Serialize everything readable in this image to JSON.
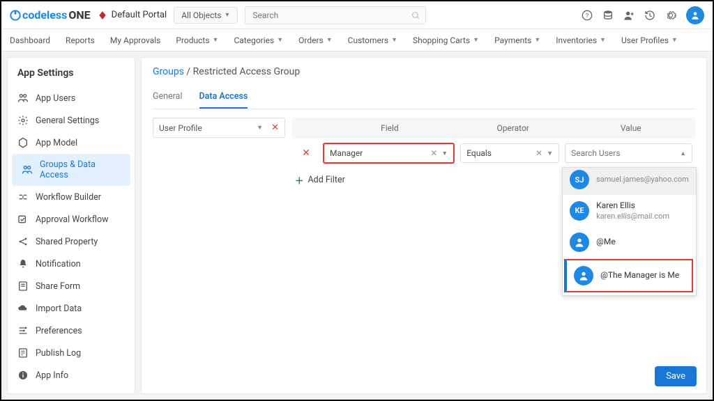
{
  "header": {
    "logo_prefix": "codeless",
    "logo_suffix": "ONE",
    "portal_label": "Default Portal",
    "objects_dd": "All Objects",
    "search_placeholder": "Search"
  },
  "nav": [
    {
      "label": "Dashboard",
      "dd": false
    },
    {
      "label": "Reports",
      "dd": false
    },
    {
      "label": "My Approvals",
      "dd": false
    },
    {
      "label": "Products",
      "dd": true
    },
    {
      "label": "Categories",
      "dd": true
    },
    {
      "label": "Orders",
      "dd": true
    },
    {
      "label": "Customers",
      "dd": true
    },
    {
      "label": "Shopping Carts",
      "dd": true
    },
    {
      "label": "Payments",
      "dd": true
    },
    {
      "label": "Inventories",
      "dd": true
    },
    {
      "label": "User Profiles",
      "dd": true
    }
  ],
  "sidebar": {
    "title": "App Settings",
    "items": [
      {
        "label": "App Users",
        "icon": "users"
      },
      {
        "label": "General Settings",
        "icon": "gear"
      },
      {
        "label": "App Model",
        "icon": "hex"
      },
      {
        "label": "Groups & Data Access",
        "icon": "users",
        "active": true
      },
      {
        "label": "Workflow Builder",
        "icon": "flow"
      },
      {
        "label": "Approval Workflow",
        "icon": "approve"
      },
      {
        "label": "Shared Property",
        "icon": "share"
      },
      {
        "label": "Notification",
        "icon": "bell"
      },
      {
        "label": "Share Form",
        "icon": "form"
      },
      {
        "label": "Import Data",
        "icon": "cloud"
      },
      {
        "label": "Preferences",
        "icon": "pref"
      },
      {
        "label": "Publish Log",
        "icon": "log"
      },
      {
        "label": "App Info",
        "icon": "info"
      }
    ]
  },
  "breadcrumb": {
    "root": "Groups",
    "current": "Restricted Access Group"
  },
  "tabs": [
    {
      "label": "General"
    },
    {
      "label": "Data Access",
      "active": true
    }
  ],
  "left_filter": "User Profile",
  "grid": {
    "headers": {
      "field": "Field",
      "operator": "Operator",
      "value": "Value"
    },
    "row": {
      "field": "Manager",
      "operator": "Equals",
      "value_placeholder": "Search Users"
    },
    "add_filter": "Add Filter"
  },
  "dropdown_options": [
    {
      "initials": "SJ",
      "color": "#1e88e5",
      "name": "",
      "email": "samuel.james@yahoo.com",
      "partial": true
    },
    {
      "initials": "KE",
      "color": "#1e88e5",
      "name": "Karen Ellis",
      "email": "karen.ellis@mail.com"
    },
    {
      "icon": "person",
      "color": "#1e88e5",
      "name": "@Me"
    },
    {
      "icon": "person",
      "color": "#1e88e5",
      "name": "@The Manager is Me",
      "selected": true
    }
  ],
  "save_label": "Save"
}
